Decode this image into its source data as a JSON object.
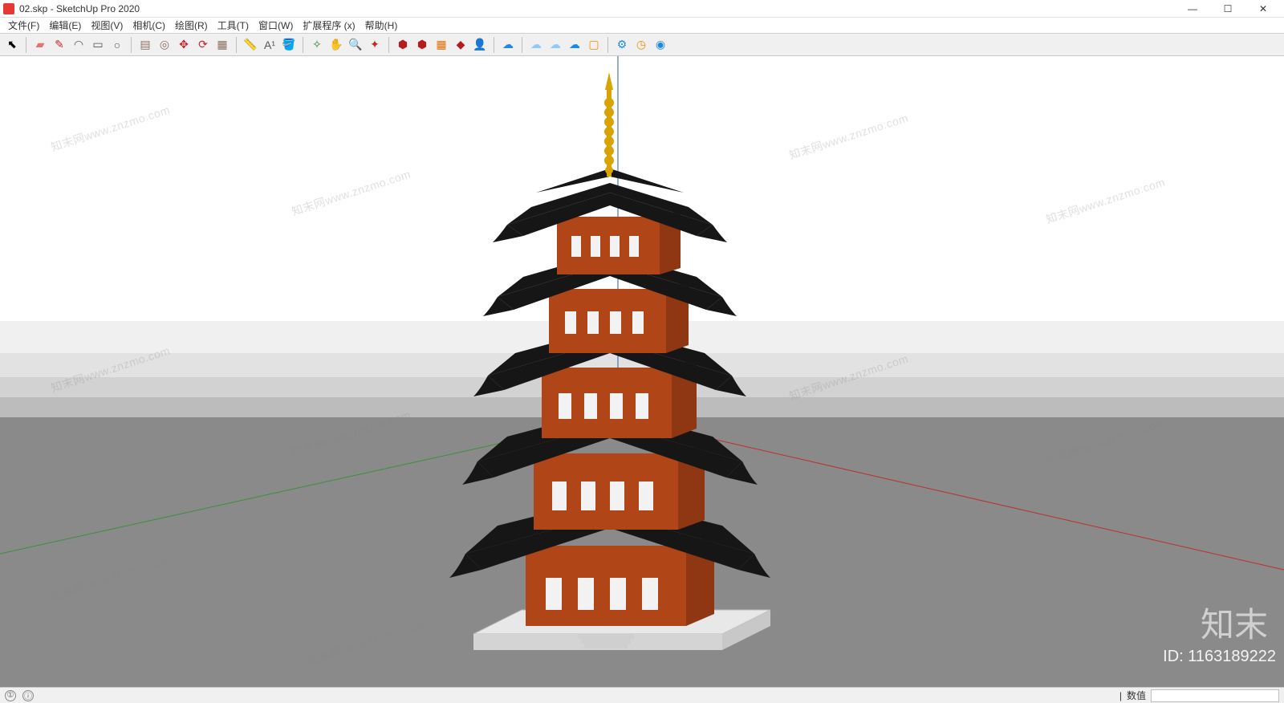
{
  "window": {
    "title": "02.skp - SketchUp Pro 2020",
    "controls": {
      "min": "—",
      "max": "☐",
      "close": "✕"
    }
  },
  "menu": {
    "items": [
      "文件(F)",
      "编辑(E)",
      "视图(V)",
      "相机(C)",
      "绘图(R)",
      "工具(T)",
      "窗口(W)",
      "扩展程序 (x)",
      "帮助(H)"
    ]
  },
  "toolbar": {
    "tools": [
      {
        "name": "select-tool",
        "glyph": "⬉",
        "color": "#000"
      },
      {
        "name": "eraser-tool",
        "glyph": "▰",
        "color": "#e57373"
      },
      {
        "name": "line-tool",
        "glyph": "✎",
        "color": "#c62828"
      },
      {
        "name": "arc-tool",
        "glyph": "◠",
        "color": "#555"
      },
      {
        "name": "rectangle-tool",
        "glyph": "▭",
        "color": "#555"
      },
      {
        "name": "circle-tool",
        "glyph": "○",
        "color": "#555"
      },
      {
        "name": "pushpull-tool",
        "glyph": "▤",
        "color": "#8d6e63"
      },
      {
        "name": "offset-tool",
        "glyph": "◎",
        "color": "#8d6e63"
      },
      {
        "name": "move-tool",
        "glyph": "✥",
        "color": "#c62828"
      },
      {
        "name": "rotate-tool",
        "glyph": "⟳",
        "color": "#c62828"
      },
      {
        "name": "scale-tool",
        "glyph": "▦",
        "color": "#8d6e63"
      },
      {
        "name": "tape-tool",
        "glyph": "📏",
        "color": "#555"
      },
      {
        "name": "text-tool",
        "glyph": "A¹",
        "color": "#555"
      },
      {
        "name": "paint-tool",
        "glyph": "🪣",
        "color": "#b8860b"
      },
      {
        "name": "orbit-tool",
        "glyph": "✧",
        "color": "#2e7d32"
      },
      {
        "name": "pan-tool",
        "glyph": "✋",
        "color": "#e0a050"
      },
      {
        "name": "zoom-tool",
        "glyph": "🔍",
        "color": "#555"
      },
      {
        "name": "zoom-extents-tool",
        "glyph": "✦",
        "color": "#c62828"
      },
      {
        "name": "warehouse-tool",
        "glyph": "⬢",
        "color": "#b71c1c"
      },
      {
        "name": "warehouse2-tool",
        "glyph": "⬢",
        "color": "#b71c1c"
      },
      {
        "name": "ext-manager-tool",
        "glyph": "▦",
        "color": "#ef6c00"
      },
      {
        "name": "layout-tool",
        "glyph": "◆",
        "color": "#b71c1c"
      },
      {
        "name": "user-tool",
        "glyph": "👤",
        "color": "#777"
      },
      {
        "name": "cloud1-tool",
        "glyph": "☁",
        "color": "#1e88e5"
      },
      {
        "name": "cloud2-tool",
        "glyph": "☁",
        "color": "#90caf9"
      },
      {
        "name": "cloud3-tool",
        "glyph": "☁",
        "color": "#90caf9"
      },
      {
        "name": "cloud4-tool",
        "glyph": "☁",
        "color": "#1e88e5"
      },
      {
        "name": "box-tool",
        "glyph": "▢",
        "color": "#fb8c00"
      },
      {
        "name": "gear2-tool",
        "glyph": "⚙",
        "color": "#1e88e5"
      },
      {
        "name": "clock-tool",
        "glyph": "◷",
        "color": "#fb8c00"
      },
      {
        "name": "chrome-tool",
        "glyph": "◉",
        "color": "#1e88e5"
      }
    ]
  },
  "viewport": {
    "sky_gradient": [
      "#ffffff",
      "#f2f2f2",
      "#e8e8e8",
      "#d9d9d9",
      "#c4c4c4",
      "#a8a8a8"
    ],
    "ground": "#8a8a8a",
    "axes": {
      "red": "#b93030",
      "green": "#3c8f3c",
      "blue": "#2e5aa8"
    },
    "model": {
      "description": "five-story pagoda",
      "body_color": "#b04618",
      "roof_color": "#161616",
      "finial_color": "#d9a300",
      "base_color": "#e8e8e8",
      "stories": 5
    }
  },
  "statusbar": {
    "hint1": "①",
    "hint2": "ⓘ",
    "divider": "|",
    "value_label": "数值",
    "value": ""
  },
  "overlay": {
    "logo": "知末",
    "id_label": "ID: 1163189222",
    "watermark_text": "知末网www.znzmo.com"
  }
}
